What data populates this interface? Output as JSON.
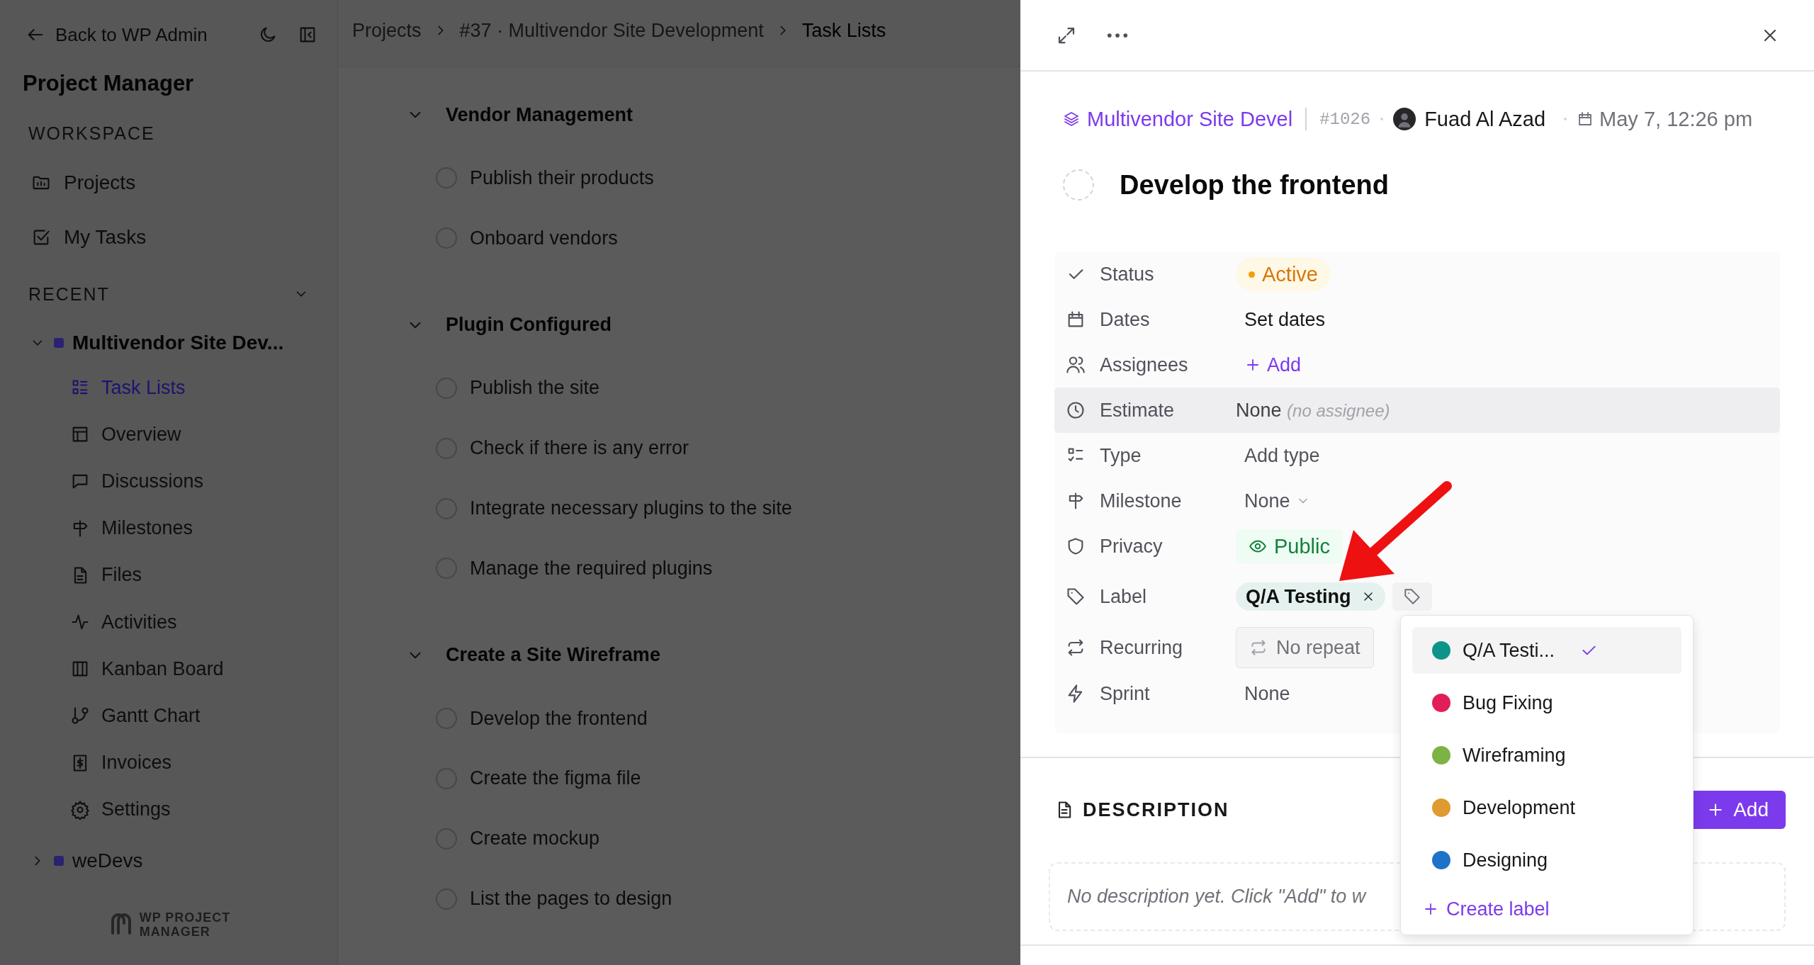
{
  "sidebar": {
    "back_link": "Back to WP Admin",
    "app_title": "Project Manager",
    "workspace_heading": "WORKSPACE",
    "workspace_items": [
      {
        "label": "Projects"
      },
      {
        "label": "My Tasks"
      }
    ],
    "recent_heading": "RECENT",
    "recent_expanded": true,
    "projects": [
      {
        "name": "Multivendor Site Dev...",
        "expanded": true,
        "children": [
          {
            "label": "Task Lists",
            "selected": true
          },
          {
            "label": "Overview",
            "selected": false
          },
          {
            "label": "Discussions",
            "selected": false
          },
          {
            "label": "Milestones",
            "selected": false
          },
          {
            "label": "Files",
            "selected": false
          },
          {
            "label": "Activities",
            "selected": false
          },
          {
            "label": "Kanban Board",
            "selected": false
          },
          {
            "label": "Gantt Chart",
            "selected": false
          },
          {
            "label": "Invoices",
            "selected": false
          },
          {
            "label": "Settings",
            "selected": false
          }
        ]
      },
      {
        "name": "weDevs",
        "expanded": false
      }
    ],
    "logo_text": [
      "WP PROJECT",
      "MANAGER"
    ]
  },
  "breadcrumb": [
    {
      "label": "Projects",
      "current": false
    },
    {
      "label": "#37 · Multivendor Site Development",
      "current": false
    },
    {
      "label": "Task Lists",
      "current": true
    }
  ],
  "task_lists": [
    {
      "title": "Vendor Management",
      "expanded": true,
      "tasks": [
        {
          "title": "Publish their products",
          "completed": false
        },
        {
          "title": "Onboard vendors",
          "completed": false
        }
      ]
    },
    {
      "title": "Plugin Configured",
      "expanded": true,
      "tasks": [
        {
          "title": "Publish the site",
          "completed": false
        },
        {
          "title": "Check if there is any error",
          "completed": false
        },
        {
          "title": "Integrate necessary plugins to the site",
          "completed": false
        },
        {
          "title": "Manage the required plugins",
          "completed": false
        }
      ]
    },
    {
      "title": "Create a Site Wireframe",
      "expanded": true,
      "tasks": [
        {
          "title": "Develop the frontend",
          "completed": false
        },
        {
          "title": "Create the figma file",
          "completed": false
        },
        {
          "title": "Create mockup",
          "completed": false
        },
        {
          "title": "List the pages to design",
          "completed": false
        }
      ]
    }
  ],
  "task_panel": {
    "project": "Multivendor Site Devel",
    "task_number": "#1026",
    "assignee": "Fuad Al Azad",
    "created": "May 7, 12:26 pm",
    "title": "Develop the frontend",
    "completed": false,
    "properties": [
      {
        "kind": "status",
        "label": "Status",
        "value": "Active",
        "hovered": false
      },
      {
        "kind": "text",
        "label": "Dates",
        "value": "Set dates",
        "hovered": false
      },
      {
        "kind": "add",
        "label": "Assignees",
        "value": "Add",
        "hovered": false
      },
      {
        "kind": "estimate",
        "label": "Estimate",
        "value": "None",
        "note": "(no assignee)",
        "hovered": true
      },
      {
        "kind": "muted",
        "label": "Type",
        "value": "Add type",
        "hovered": false
      },
      {
        "kind": "dropdown",
        "label": "Milestone",
        "value": "None",
        "hovered": false
      },
      {
        "kind": "privacy",
        "label": "Privacy",
        "value": "Public",
        "hovered": false
      },
      {
        "kind": "label",
        "label": "Label",
        "value": "Q/A Testing",
        "hovered": false
      },
      {
        "kind": "recurring",
        "label": "Recurring",
        "value": "No repeat",
        "hovered": false
      },
      {
        "kind": "muted",
        "label": "Sprint",
        "value": "None",
        "hovered": false
      }
    ],
    "description_heading": "DESCRIPTION",
    "add_button": "Add",
    "description_placeholder": "No description yet. Click \"Add\" to w",
    "label_menu": {
      "open": true,
      "options": [
        {
          "name": "Q/A Testi...",
          "color": "#0d9488",
          "selected": true
        },
        {
          "name": "Bug Fixing",
          "color": "#e11d5a",
          "selected": false
        },
        {
          "name": "Wireframing",
          "color": "#7cb342",
          "selected": false
        },
        {
          "name": "Development",
          "color": "#e09a30",
          "selected": false
        },
        {
          "name": "Designing",
          "color": "#1e73c8",
          "selected": false
        }
      ],
      "create_label": "Create label"
    }
  }
}
